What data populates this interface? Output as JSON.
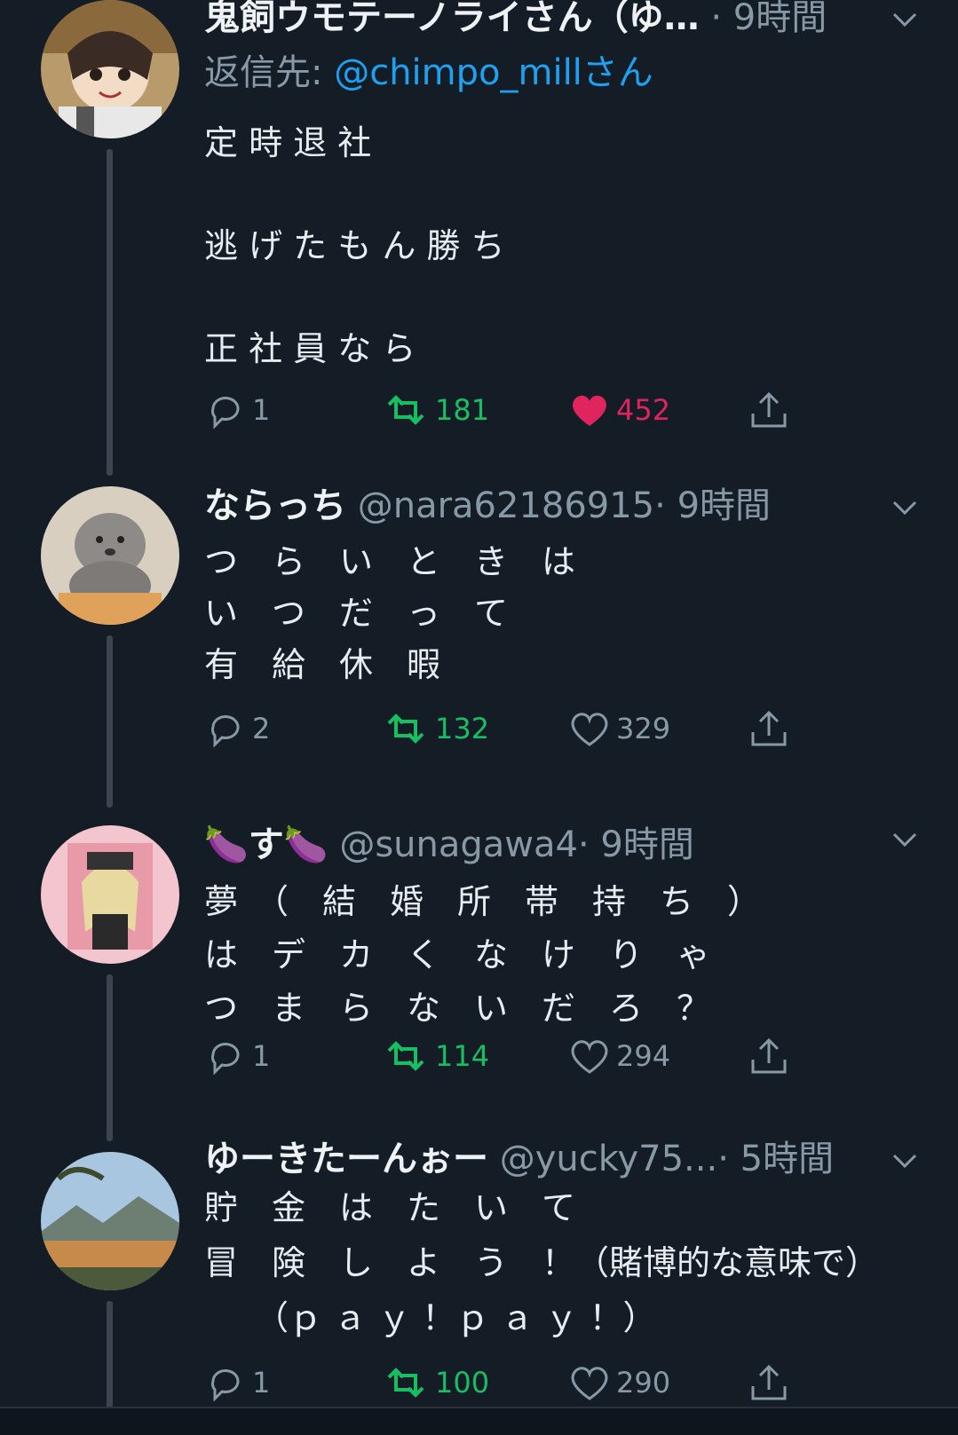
{
  "tweets": [
    {
      "name": "鬼飼ウモテーノライさん（ゆ…",
      "handle": "",
      "time": "· 9時間",
      "reply_label": "返信先: ",
      "reply_mention": "@chimpo_millさん",
      "body": "定 時 退 社\n\n逃 げ た も ん 勝 ち\n\n正 社 員 な ら",
      "replies": "1",
      "retweets": "181",
      "likes": "452",
      "liked": true
    },
    {
      "name": "ならっち",
      "handle": "@nara62186915",
      "time": "· 9時間",
      "body": "つ　ら　い　と　き　は\nい　つ　だ　っ　て\n有　給　休　暇",
      "replies": "2",
      "retweets": "132",
      "likes": "329",
      "liked": false
    },
    {
      "name": "🍆す🍆",
      "handle": "@sunagawa4",
      "time": "· 9時間",
      "body": "夢　（　結　婚　所　帯　持　ち　）\nは　デ　カ　く　な　け　り　ゃ\nつ　ま　ら　な　い　だ　ろ　？",
      "replies": "1",
      "retweets": "114",
      "likes": "294",
      "liked": false
    },
    {
      "name": "ゆーきたーんぉー",
      "handle": "@yucky75...",
      "time": "· 5時間",
      "body": "貯　金　は　た　い　て\n冒　険　し　よ　う　！（賭博的な意味で）\n　　（ｐ ａ ｙ ！ｐ ａ ｙ ！）",
      "replies": "1",
      "retweets": "100",
      "likes": "290",
      "liked": false
    }
  ],
  "colors": {
    "background": "#141c26",
    "handle": "#8899a6",
    "mention": "#1da1f2",
    "retweet": "#17bf63",
    "like": "#e0245e"
  }
}
